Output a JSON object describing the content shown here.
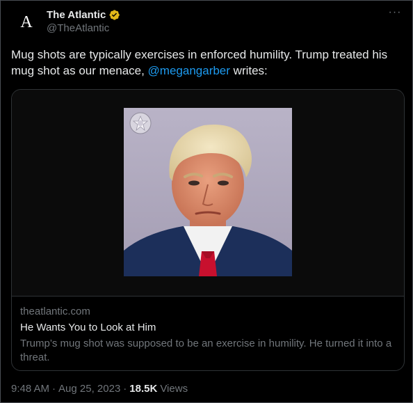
{
  "author": {
    "avatar_letter": "A",
    "display_name": "The Atlantic",
    "handle": "@TheAtlantic",
    "verified_badge": "gold-verified-icon"
  },
  "menu_icon": "more-icon",
  "tweet": {
    "text_before": "Mug shots are typically exercises in enforced humility. Trump treated his mug shot as our menace, ",
    "mention": "@megangarber",
    "text_after": " writes:"
  },
  "card": {
    "image": "mug-shot-photo",
    "domain": "theatlantic.com",
    "title": "He Wants You to Look at Him",
    "description": "Trump’s mug shot was supposed to be an exercise in humility. He turned it into a threat."
  },
  "footer": {
    "time": "9:48 AM",
    "separator": "·",
    "date": "Aug 25, 2023",
    "views_count": "18.5K",
    "views_label": "Views"
  },
  "colors": {
    "background": "#000000",
    "text": "#e7e9ea",
    "muted": "#71767b",
    "link": "#1d9bf0",
    "verified": "#e2b719"
  }
}
